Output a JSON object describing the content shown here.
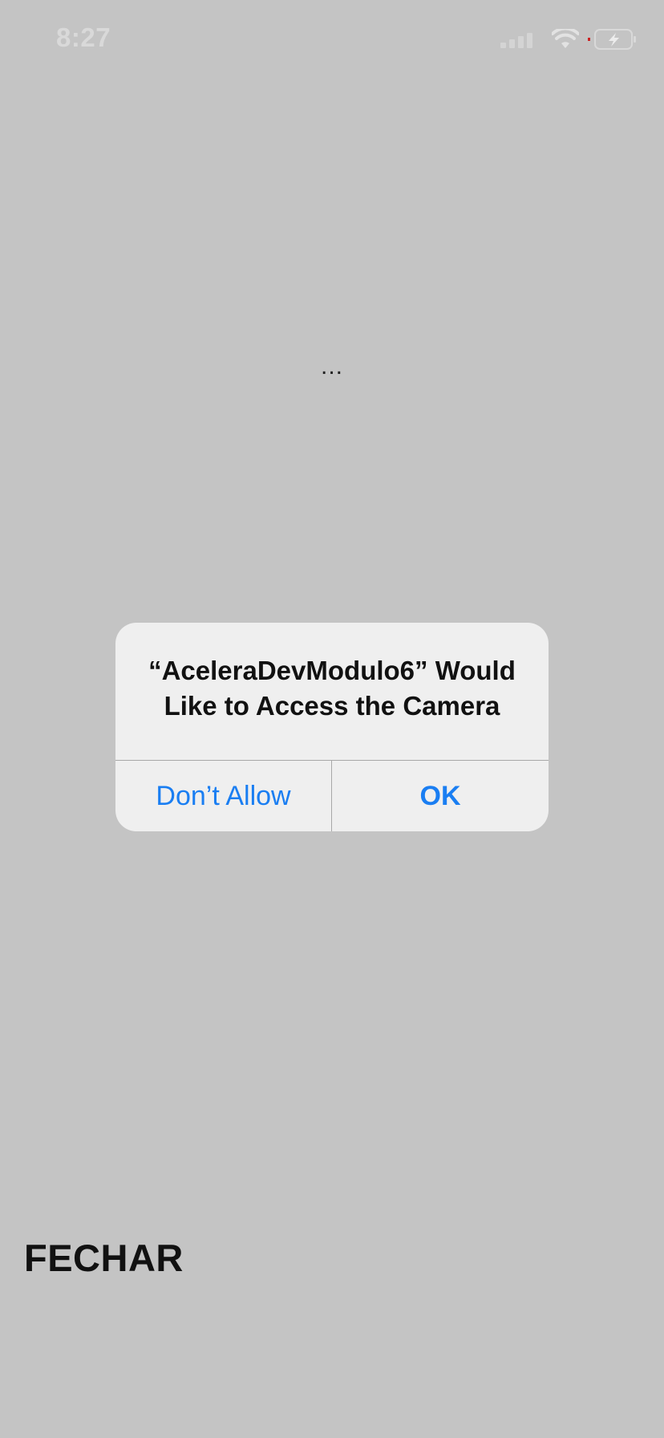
{
  "status_bar": {
    "time": "8:27",
    "icons": [
      "signal-icon",
      "wifi-icon",
      "battery-charging-icon"
    ]
  },
  "main": {
    "loading_text": "..."
  },
  "alert": {
    "title": "“AceleraDevModulo6” Would\nLike to Access the Camera",
    "deny_label": "Don’t Allow",
    "ok_label": "OK",
    "button_color": "#1a7ef2"
  },
  "footer": {
    "close_label": "FECHAR"
  },
  "colors": {
    "background": "#c4c4c4",
    "alert_background": "#efefef"
  }
}
